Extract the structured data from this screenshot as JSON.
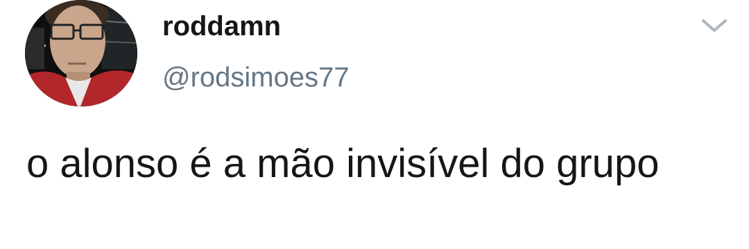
{
  "tweet": {
    "author": {
      "display_name": "roddamn",
      "handle": "@rodsimoes77",
      "avatar_icon": "user-selfie-photo"
    },
    "text": "o alonso é a mão invisível do grupo",
    "menu_icon": "chevron-down-icon"
  },
  "colors": {
    "text_primary": "#14171a",
    "text_secondary": "#657786",
    "icon": "#aab8c2",
    "background": "#ffffff"
  }
}
